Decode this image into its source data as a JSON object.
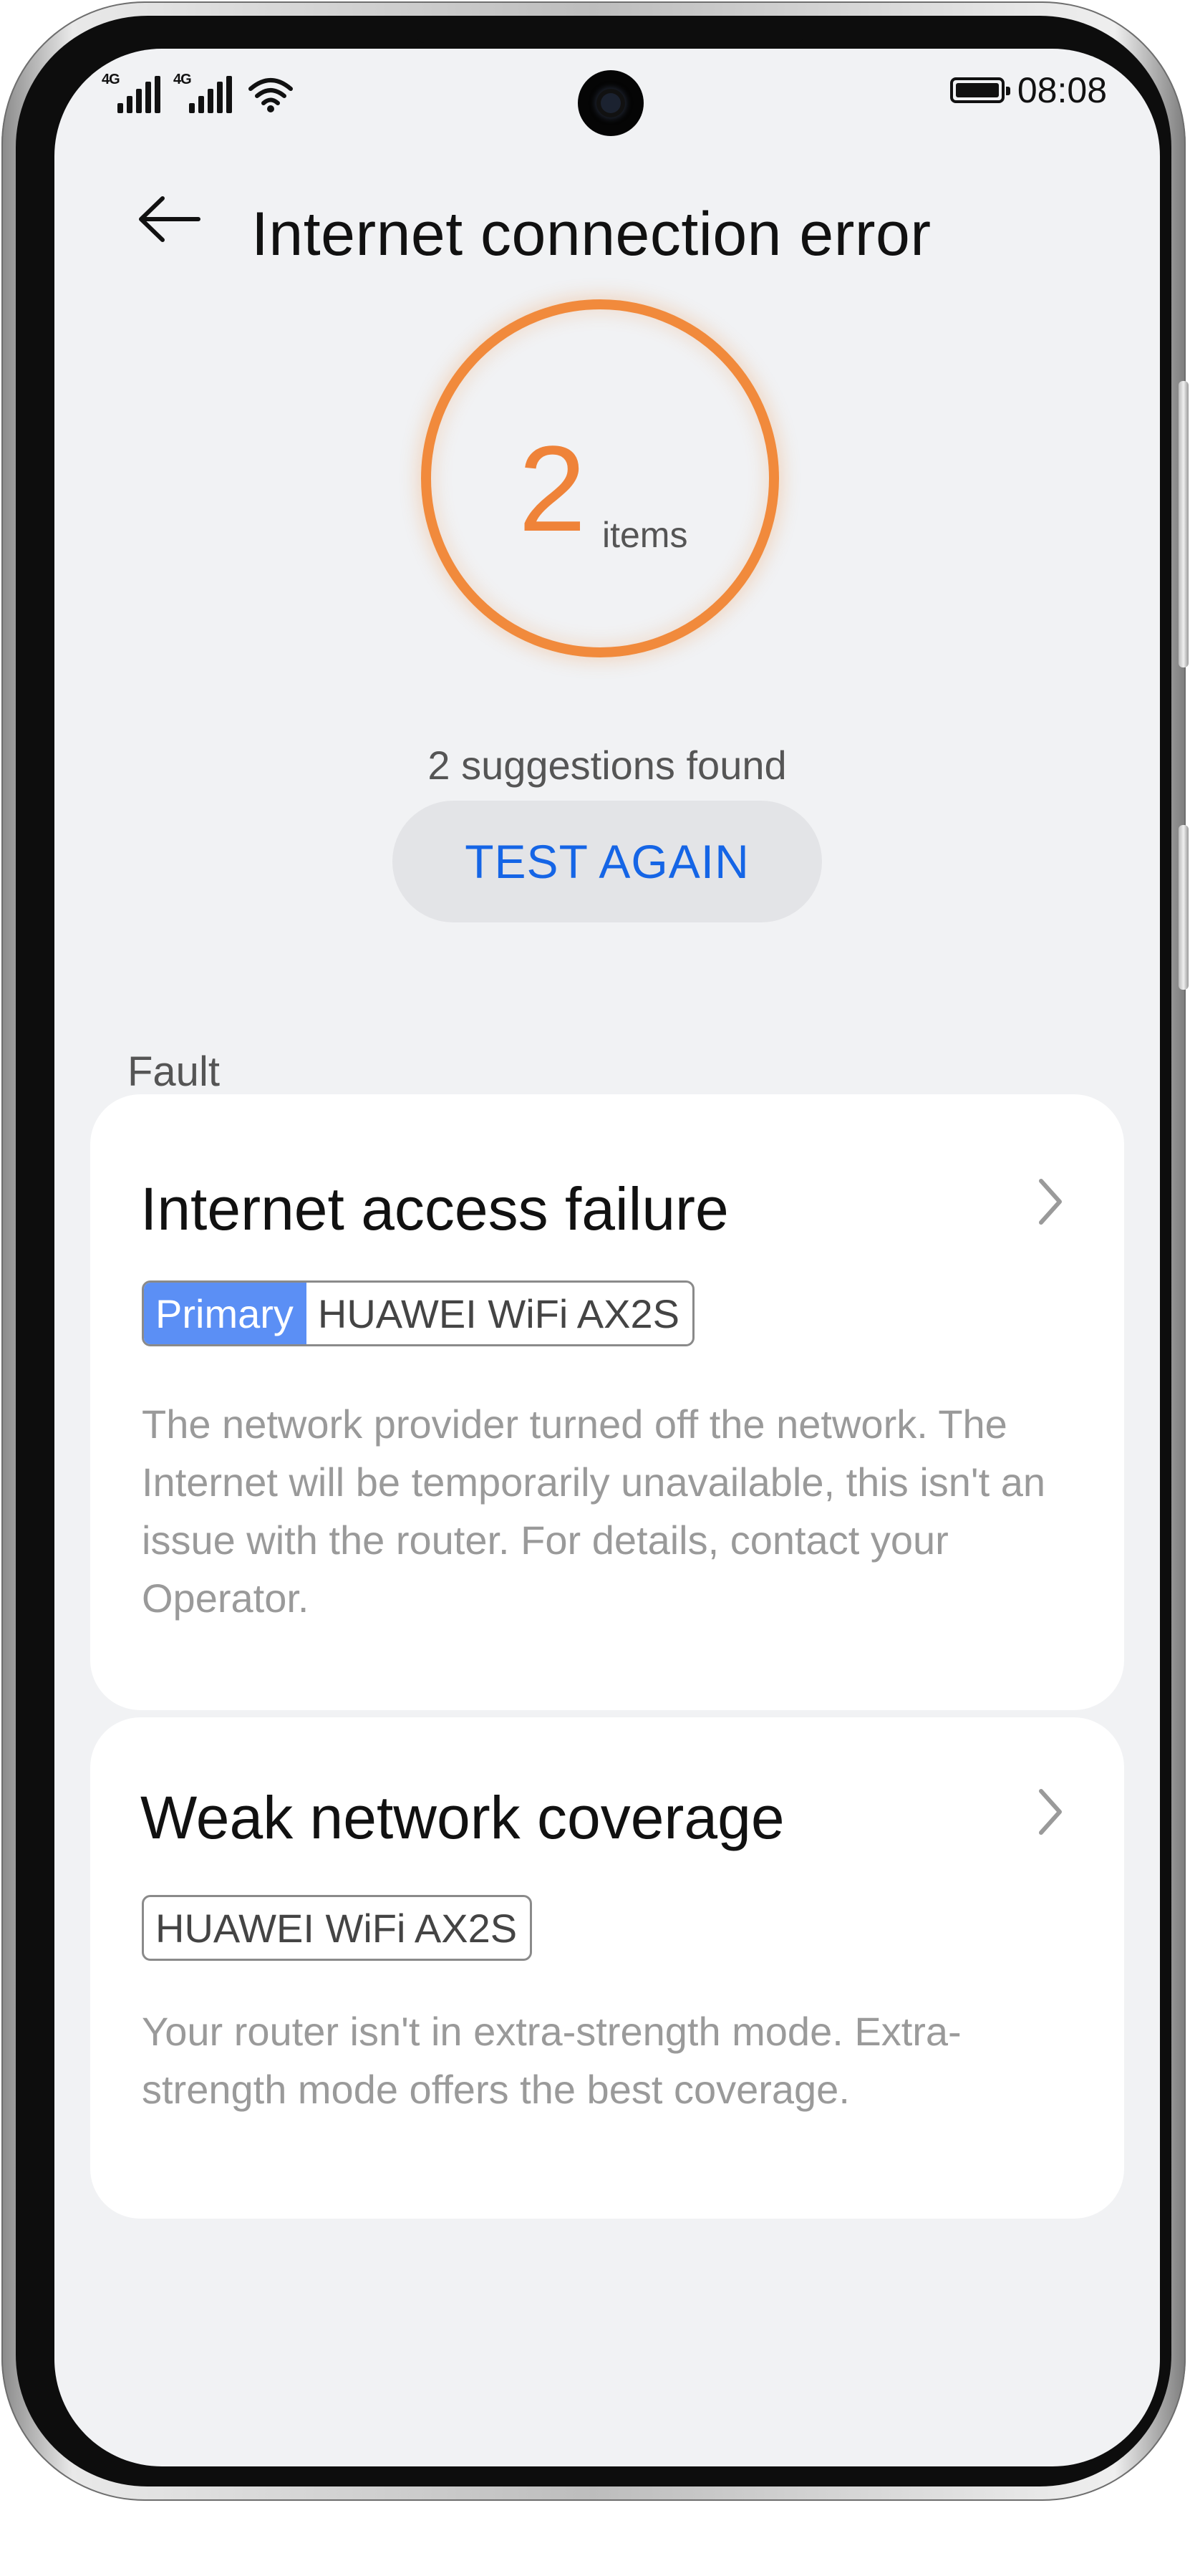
{
  "status_bar": {
    "sim1_tech": "4G",
    "sim2_tech": "4G",
    "time": "08:08"
  },
  "header": {
    "title": "Internet connection error"
  },
  "result": {
    "count": "2",
    "unit": "items",
    "summary": "2 suggestions found",
    "button_label": "TEST AGAIN",
    "accent_color": "#ef8339"
  },
  "section": {
    "label": "Fault"
  },
  "faults": [
    {
      "title": "Internet access failure",
      "tag_primary": "Primary",
      "device": "HUAWEI WiFi AX2S",
      "description": "The network provider turned off the network. The Internet will be temporarily unavailable, this isn't an issue with the router. For details, contact your Operator."
    },
    {
      "title": "Weak network coverage",
      "device": "HUAWEI WiFi AX2S",
      "description": "Your router isn't in extra-strength mode. Extra-strength mode offers the best coverage."
    }
  ],
  "colors": {
    "link_blue": "#1565e6",
    "primary_tag": "#5b8ff5",
    "background": "#f1f2f4"
  }
}
